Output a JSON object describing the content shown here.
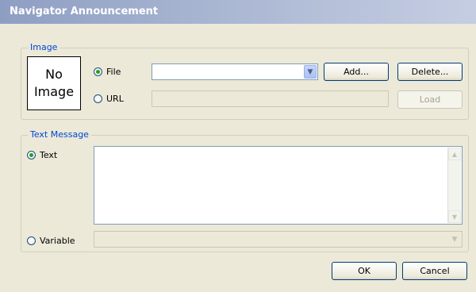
{
  "window": {
    "title": "Navigator Announcement"
  },
  "image_group": {
    "title": "Image",
    "no_image_line1": "No",
    "no_image_line2": "Image",
    "file_label": "File",
    "url_label": "URL",
    "file_value": "",
    "url_value": "",
    "add_label": "Add...",
    "delete_label": "Delete...",
    "load_label": "Load",
    "selected": "File"
  },
  "text_group": {
    "title": "Text Message",
    "text_label": "Text",
    "variable_label": "Variable",
    "text_value": "",
    "variable_value": "",
    "selected": "Text"
  },
  "footer": {
    "ok_label": "OK",
    "cancel_label": "Cancel"
  },
  "colors": {
    "group_title": "#0046d5",
    "title_bar": "#a9b6d2",
    "radio_dot": "#21a121"
  }
}
